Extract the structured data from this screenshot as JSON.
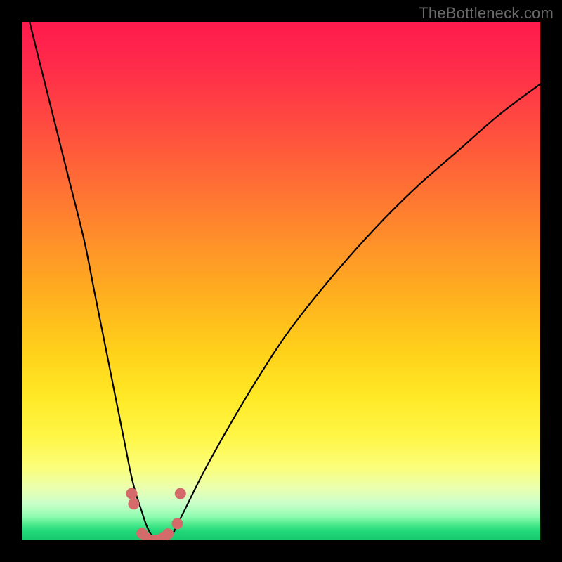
{
  "watermark": "TheBottleneck.com",
  "chart_data": {
    "type": "line",
    "title": "",
    "xlabel": "",
    "ylabel": "",
    "xlim": [
      0,
      100
    ],
    "ylim": [
      0,
      100
    ],
    "grid": false,
    "series": [
      {
        "name": "bottleneck-curve",
        "x": [
          0,
          3,
          6,
          9,
          12,
          14,
          16,
          18,
          19,
          20,
          21,
          22,
          23,
          24,
          25,
          26,
          27,
          28,
          29,
          30,
          32,
          35,
          40,
          46,
          52,
          60,
          68,
          76,
          84,
          92,
          100
        ],
        "values": [
          106,
          94,
          82,
          70,
          58,
          48,
          38,
          28,
          23,
          18,
          13,
          9,
          6,
          3,
          1,
          0,
          0,
          0,
          1,
          3,
          7,
          13,
          22,
          32,
          41,
          51,
          60,
          68,
          75,
          82,
          88
        ]
      }
    ],
    "markers": {
      "name": "trough-dots",
      "color": "#d46a6a",
      "points": [
        {
          "x": 21.2,
          "y": 9.0
        },
        {
          "x": 21.6,
          "y": 7.0
        },
        {
          "x": 23.2,
          "y": 1.3
        },
        {
          "x": 24.2,
          "y": 0.3
        },
        {
          "x": 25.0,
          "y": 0.0
        },
        {
          "x": 26.0,
          "y": 0.0
        },
        {
          "x": 27.2,
          "y": 0.4
        },
        {
          "x": 28.2,
          "y": 1.2
        },
        {
          "x": 30.0,
          "y": 3.2
        },
        {
          "x": 30.6,
          "y": 9.0
        }
      ]
    }
  }
}
